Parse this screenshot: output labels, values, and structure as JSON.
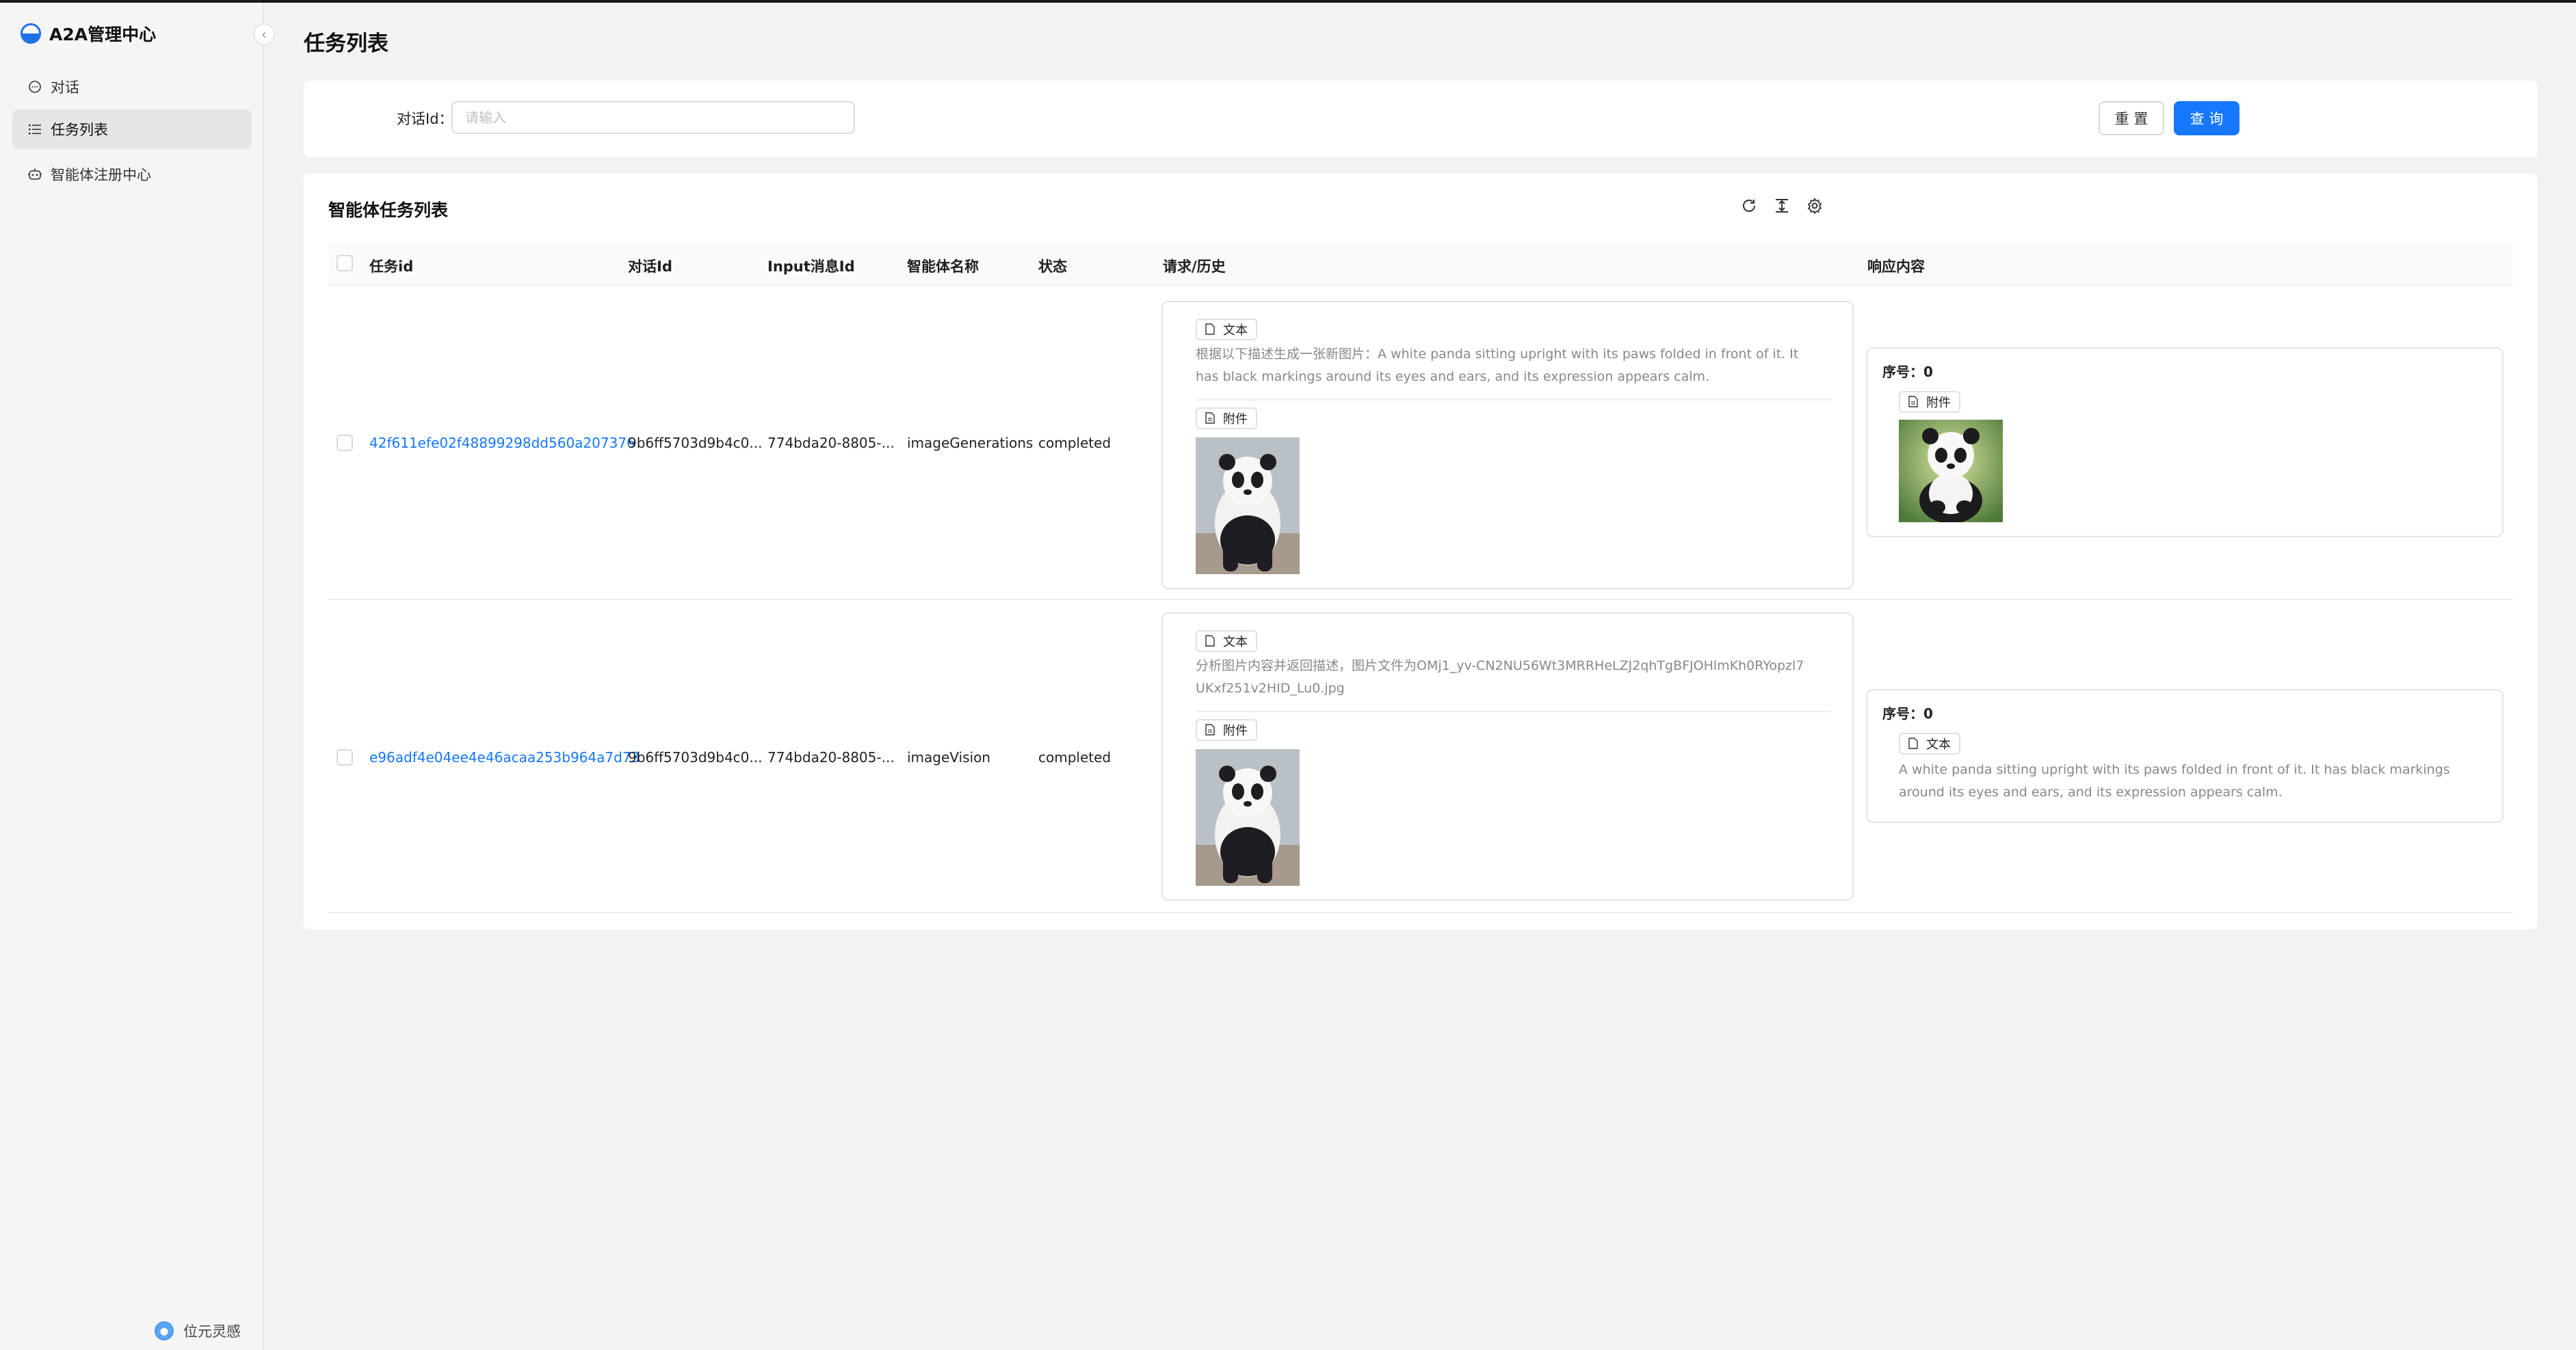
{
  "app": {
    "title": "A2A管理中心"
  },
  "sidebar": {
    "items": [
      {
        "label": "对话",
        "icon": "chat-bubble-icon"
      },
      {
        "label": "任务列表",
        "icon": "list-icon"
      },
      {
        "label": "智能体注册中心",
        "icon": "robot-icon"
      }
    ],
    "footer_label": "位元灵感"
  },
  "page": {
    "title": "任务列表"
  },
  "filter": {
    "label": "对话Id：",
    "placeholder": "请输入",
    "reset_label": "重 置",
    "query_label": "查 询"
  },
  "table": {
    "title": "智能体任务列表",
    "toolbar_icons": [
      "reload-icon",
      "column-height-icon",
      "settings-icon"
    ],
    "columns": [
      "任务id",
      "对话Id",
      "Input消息Id",
      "智能体名称",
      "状态",
      "请求/历史",
      "响应内容"
    ],
    "rows": [
      {
        "task_id": "42f611efe02f48899298dd560a207376",
        "conversation_id": "9b6ff5703d9b4c0...",
        "input_message_id": "774bda20-8805-...",
        "agent_name": "imageGenerations",
        "status": "completed",
        "request": {
          "text_tag": "文本",
          "text": "根据以下描述生成一张新图片：A white panda sitting upright with its paws folded in front of it. It has black markings around its eyes and ears, and its expression appears calm.",
          "attachment_tag": "附件"
        },
        "response": {
          "seq_label": "序号：0",
          "part_tag": "附件"
        }
      },
      {
        "task_id": "e96adf4e04ee4e46acaa253b964a7d73",
        "conversation_id": "9b6ff5703d9b4c0...",
        "input_message_id": "774bda20-8805-...",
        "agent_name": "imageVision",
        "status": "completed",
        "request": {
          "text_tag": "文本",
          "text": "分析图片内容并返回描述，图片文件为OMj1_yv-CN2NU56Wt3MRRHeLZJ2qhTgBFJOHlmKh0RYopzl7UKxf251v2HID_Lu0.jpg",
          "attachment_tag": "附件"
        },
        "response": {
          "seq_label": "序号：0",
          "part_tag": "文本",
          "text": "A white panda sitting upright with its paws folded in front of it. It has black markings around its eyes and ears, and its expression appears calm."
        }
      }
    ]
  },
  "colors": {
    "primary": "#1677ff",
    "sidebar_bg": "#f5f5f5",
    "page_bg": "#f2f2f3"
  }
}
